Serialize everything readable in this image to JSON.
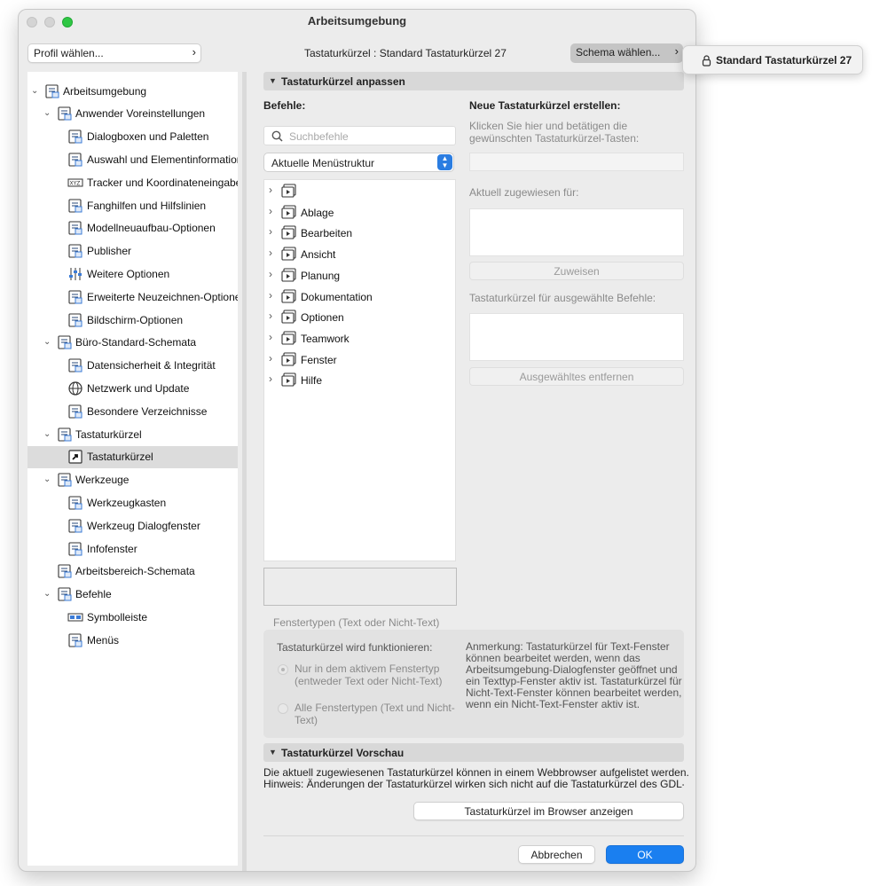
{
  "window": {
    "title": "Arbeitsumgebung"
  },
  "top": {
    "profile_label": "Profil wählen...",
    "shortcut_caption": "Tastaturkürzel : Standard Tastaturkürzel 27",
    "schema_label": "Schema wählen...",
    "schema_popup": "Standard Tastaturkürzel 27"
  },
  "sidebar": {
    "items": [
      {
        "label": "Arbeitsumgebung",
        "level": 0,
        "expanded": true,
        "icon": "workspace-icon"
      },
      {
        "label": "Anwender Voreinstellungen",
        "level": 1,
        "expanded": true,
        "icon": "user-prefs-icon"
      },
      {
        "label": "Dialogboxen und Paletten",
        "level": 2,
        "icon": "dialogs-palettes-icon"
      },
      {
        "label": "Auswahl und Elementinformation",
        "level": 2,
        "icon": "selection-info-icon"
      },
      {
        "label": "Tracker und Koordinateneingabe",
        "level": 2,
        "icon": "xyz-tracker-icon"
      },
      {
        "label": "Fanghilfen und Hilfslinien",
        "level": 2,
        "icon": "snap-guides-icon"
      },
      {
        "label": "Modellneuaufbau-Optionen",
        "level": 2,
        "icon": "model-rebuild-icon"
      },
      {
        "label": "Publisher",
        "level": 2,
        "icon": "publisher-icon"
      },
      {
        "label": "Weitere Optionen",
        "level": 2,
        "icon": "sliders-icon"
      },
      {
        "label": "Erweiterte Neuzeichnen-Optionen",
        "level": 2,
        "icon": "redraw-options-icon"
      },
      {
        "label": "Bildschirm-Optionen",
        "level": 2,
        "icon": "screen-options-icon"
      },
      {
        "label": "Büro-Standard-Schemata",
        "level": 1,
        "expanded": true,
        "icon": "office-schemes-icon"
      },
      {
        "label": "Datensicherheit & Integrität",
        "level": 2,
        "icon": "data-safety-icon"
      },
      {
        "label": "Netzwerk und Update",
        "level": 2,
        "icon": "globe-icon"
      },
      {
        "label": "Besondere Verzeichnisse",
        "level": 2,
        "icon": "folders-icon"
      },
      {
        "label": "Tastaturkürzel",
        "level": 1,
        "expanded": true,
        "icon": "keyboard-shortcuts-icon"
      },
      {
        "label": "Tastaturkürzel",
        "level": 2,
        "selected": true,
        "icon": "shortcut-arrow-icon"
      },
      {
        "label": "Werkzeuge",
        "level": 1,
        "expanded": true,
        "icon": "tools-icon"
      },
      {
        "label": "Werkzeugkasten",
        "level": 2,
        "icon": "toolbox-icon"
      },
      {
        "label": "Werkzeug Dialogfenster",
        "level": 2,
        "icon": "tool-dialog-icon"
      },
      {
        "label": "Infofenster",
        "level": 2,
        "icon": "info-box-icon"
      },
      {
        "label": "Arbeitsbereich-Schemata",
        "level": 1,
        "icon": "work-env-schemes-icon"
      },
      {
        "label": "Befehle",
        "level": 1,
        "expanded": true,
        "icon": "commands-icon"
      },
      {
        "label": "Symbolleiste",
        "level": 2,
        "icon": "toolbar-icon"
      },
      {
        "label": "Menüs",
        "level": 2,
        "icon": "menus-icon"
      }
    ]
  },
  "shortcuts": {
    "header": "Tastaturkürzel anpassen",
    "commands_label": "Befehle:",
    "search_placeholder": "Suchbefehle",
    "structure_select": "Aktuelle Menüstruktur",
    "menu_items": [
      "",
      "Ablage",
      "Bearbeiten",
      "Ansicht",
      "Planung",
      "Dokumentation",
      "Optionen",
      "Teamwork",
      "Fenster",
      "Hilfe"
    ],
    "new_title": "Neue Tastaturkürzel erstellen:",
    "new_hint": "Klicken Sie hier und betätigen die gewünschten Tastaturkürzel-Tasten:",
    "assigned_label": "Aktuell zugewiesen für:",
    "assign_button": "Zuweisen",
    "selected_label": "Tastaturkürzel für ausgewählte Befehle:",
    "remove_button": "Ausgewähltes entfernen",
    "window_types_label": "Fenstertypen (Text oder Nicht-Text)",
    "works_label": "Tastaturkürzel wird funktionieren:",
    "radio_active": "Nur in dem aktivem Fenstertyp (entweder Text oder Nicht-Text)",
    "radio_all": "Alle Fenstertypen (Text und Nicht-Text)",
    "note": "Anmerkung: Tastaturkürzel für Text-Fenster können bearbeitet werden, wenn das Arbeitsumgebung-Dialogfenster geöffnet und ein Texttyp-Fenster aktiv ist. Tastaturkürzel für Nicht-Text-Fenster können bearbeitet werden, wenn ein Nicht-Text-Fenster aktiv ist."
  },
  "preview": {
    "header": "Tastaturkürzel Vorschau",
    "line1": "Die aktuell zugewiesenen Tastaturkürzel können in einem  Webbrowser aufgelistet werden.",
    "line2": "Hinweis: Änderungen der Tastaturkürzel wirken sich nicht auf die Tastaturkürzel des GDL-",
    "browser_button": "Tastaturkürzel im Browser anzeigen"
  },
  "footer": {
    "cancel": "Abbrechen",
    "ok": "OK"
  },
  "colors": {
    "accent": "#1a7ff0",
    "selected_row": "#dcdcdc",
    "header_bg": "#d8d8d8"
  }
}
